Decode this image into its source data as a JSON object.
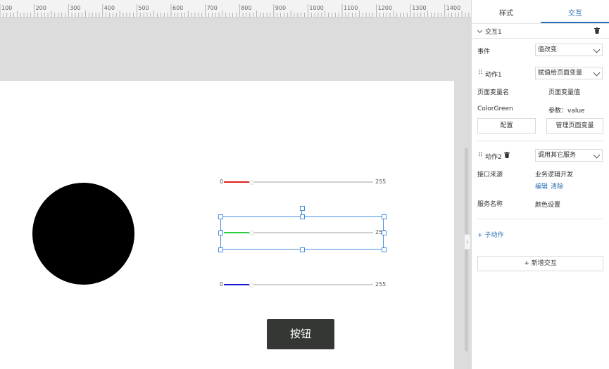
{
  "ruler": {
    "labels": [
      "100",
      "200",
      "300",
      "400",
      "500",
      "600",
      "700",
      "800",
      "900",
      "1000",
      "1100",
      "1200",
      "1300",
      "1400"
    ]
  },
  "canvas": {
    "sliders": [
      {
        "min": "0",
        "max": "255",
        "color": "#e02020",
        "fraction": 0.17
      },
      {
        "min": "0",
        "max": "255",
        "color": "#2ecc40",
        "fraction": 0.17
      },
      {
        "min": "0",
        "max": "255",
        "color": "#1a1acc",
        "fraction": 0.17
      }
    ],
    "button_label": "按钮",
    "circle_color": "#000000"
  },
  "panel": {
    "tabs": [
      {
        "label": "样式"
      },
      {
        "label": "交互"
      }
    ],
    "interaction": {
      "title": "交互1",
      "event_label": "事件",
      "event_value": "值改变",
      "action1": {
        "label": "动作1",
        "type": "赋值给页面变量",
        "col_var_name": "页面变量名",
        "col_var_value": "页面变量值",
        "var_name": "ColorGreen",
        "var_value": "参数：value",
        "config_button": "配置",
        "manage_button": "管理页面变量"
      },
      "action2": {
        "label": "动作2",
        "type": "调用其它服务",
        "source_label": "接口来源",
        "source_value": "业务逻辑开发",
        "edit_link": "编辑",
        "clear_link": "清除",
        "service_label": "服务名称",
        "service_value": "颜色设置"
      },
      "sub_action": "+ 子动作",
      "add_interaction": "+ 新增交互"
    }
  }
}
